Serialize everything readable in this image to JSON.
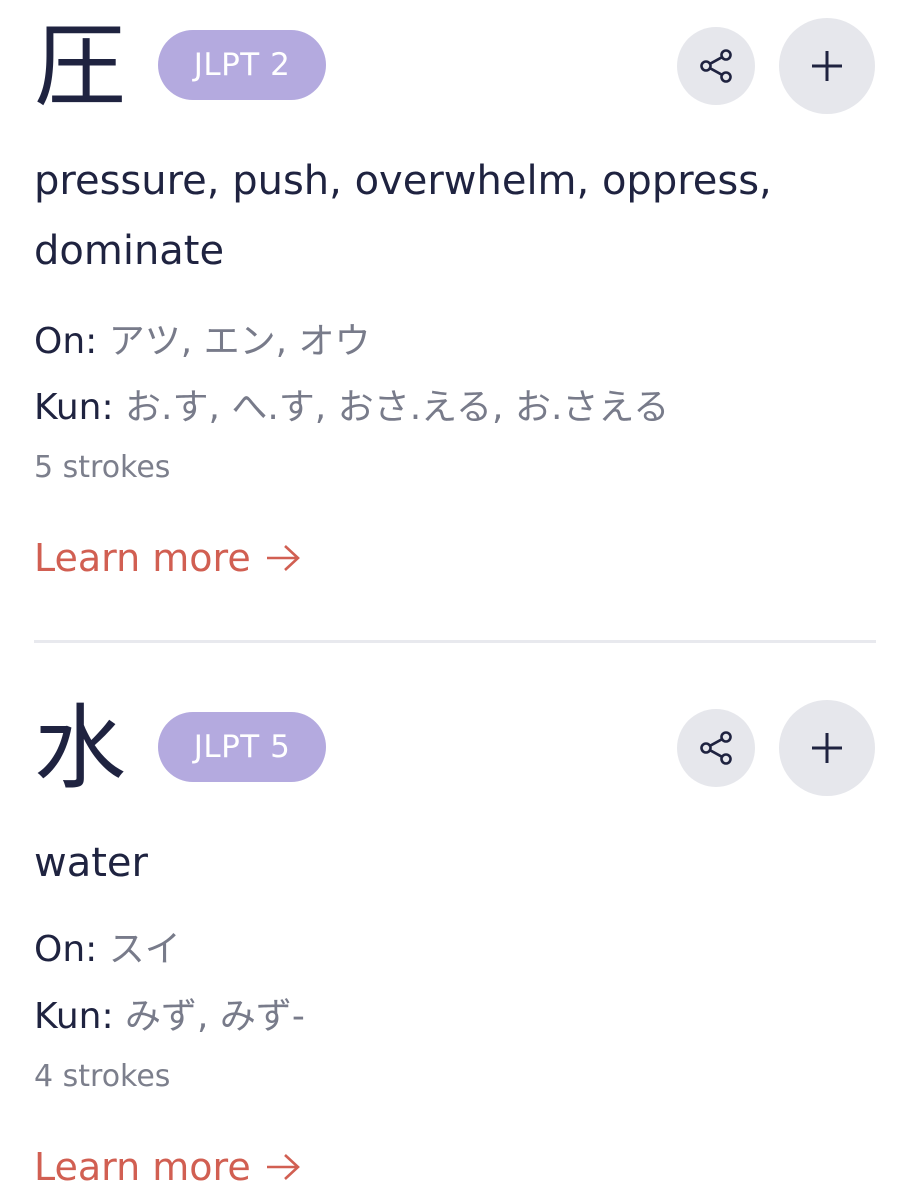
{
  "entries": [
    {
      "kanji": "圧",
      "jlpt": "JLPT 2",
      "meaning": "pressure, push, overwhelm, oppress, dominate",
      "on_label": "On:",
      "on": "アツ, エン, オウ",
      "kun_label": "Kun:",
      "kun": "お.す, へ.す, おさ.える, お.さえる",
      "strokes": "5 strokes",
      "learn_more": "Learn more"
    },
    {
      "kanji": "水",
      "jlpt": "JLPT 5",
      "meaning": "water",
      "on_label": "On:",
      "on": "スイ",
      "kun_label": "Kun:",
      "kun": "みず, みず-",
      "strokes": "4 strokes",
      "learn_more": "Learn more"
    }
  ],
  "icons": {
    "share": "share-icon",
    "add": "plus-icon",
    "arrow": "arrow-right-icon"
  },
  "colors": {
    "badge": "#b4aadf",
    "link": "#d15f52",
    "button_bg": "#e6e7ec",
    "text": "#1f2340",
    "muted": "#787b8a"
  }
}
